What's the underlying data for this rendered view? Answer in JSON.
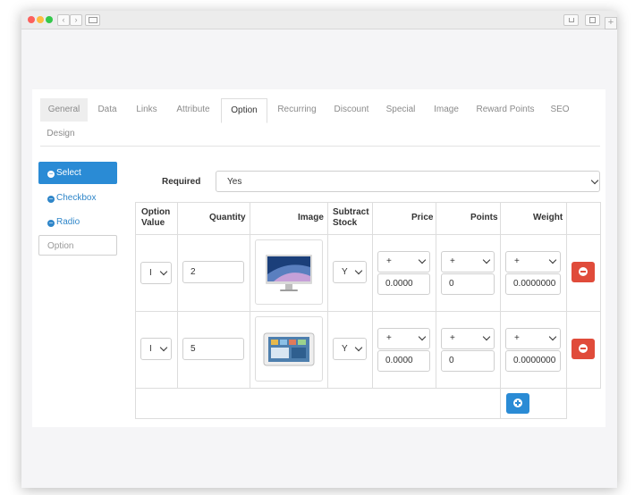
{
  "tabs": [
    "General",
    "Data",
    "Links",
    "Attribute",
    "Option",
    "Recurring",
    "Discount",
    "Special",
    "Image",
    "Reward Points",
    "SEO",
    "Design"
  ],
  "active_tab": "Option",
  "option_list": {
    "items": [
      "Select",
      "Checkbox",
      "Radio"
    ],
    "active": "Select",
    "input_placeholder": "Option"
  },
  "required": {
    "label": "Required",
    "value": "Yes"
  },
  "table": {
    "headers": {
      "option_value_line1": "Option",
      "option_value_line2": "Value",
      "quantity": "Quantity",
      "image": "Image",
      "subtract_line1": "Subtract",
      "subtract_line2": "Stock",
      "price": "Price",
      "points": "Points",
      "weight": "Weight"
    },
    "rows": [
      {
        "option_value": "I",
        "quantity": "2",
        "image": "monitor-thumbnail",
        "subtract": "Y",
        "price_prefix": "+",
        "price": "0.0000",
        "points_prefix": "+",
        "points": "0",
        "weight_prefix": "+",
        "weight": "0.0000000"
      },
      {
        "option_value": "I",
        "quantity": "5",
        "image": "tablet-thumbnail",
        "subtract": "Y",
        "price_prefix": "+",
        "price": "0.0000",
        "points_prefix": "+",
        "points": "0",
        "weight_prefix": "+",
        "weight": "0.0000000"
      }
    ]
  },
  "colors": {
    "primary": "#2a8bd5",
    "danger": "#e04b3a",
    "link": "#2f86c9"
  }
}
